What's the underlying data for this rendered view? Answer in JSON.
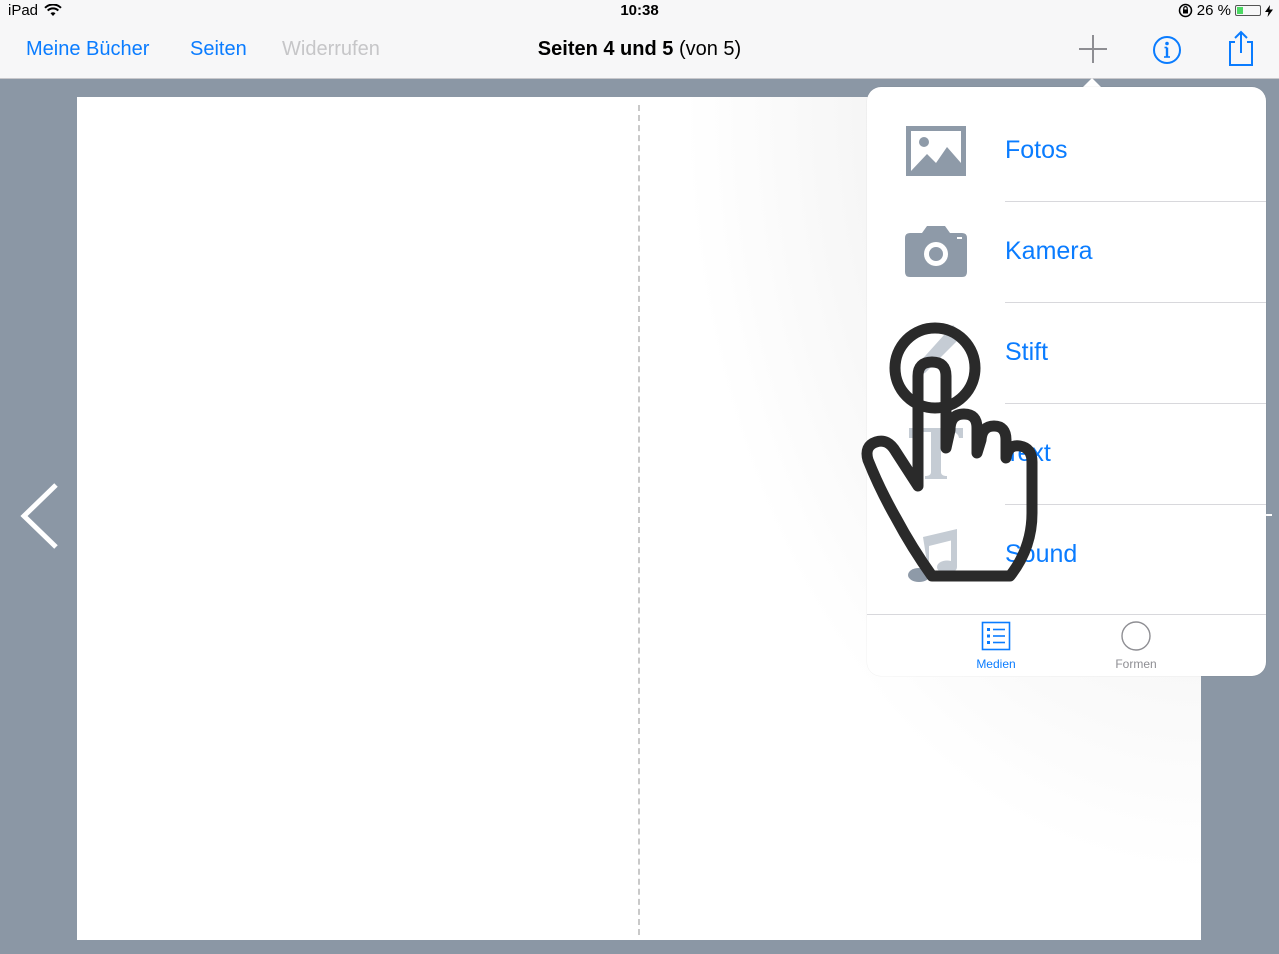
{
  "statusbar": {
    "device": "iPad",
    "time": "10:38",
    "battery": "26 %",
    "battery_level": 0.26
  },
  "navbar": {
    "my_books": "Meine Bücher",
    "pages": "Seiten",
    "undo": "Widerrufen",
    "title_bold": "Seiten 4 und 5",
    "title_rest": " (von 5)"
  },
  "popover": {
    "items": [
      {
        "label": "Fotos",
        "icon": "photo-icon"
      },
      {
        "label": "Kamera",
        "icon": "camera-icon"
      },
      {
        "label": "Stift",
        "icon": "pen-icon"
      },
      {
        "label": "Text",
        "icon": "text-icon"
      },
      {
        "label": "Sound",
        "icon": "music-note-icon"
      }
    ],
    "tabs": [
      {
        "label": "Medien",
        "icon": "list-icon",
        "active": true
      },
      {
        "label": "Formen",
        "icon": "circle-icon",
        "active": false
      }
    ]
  },
  "colors": {
    "accent": "#0a7cff",
    "background": "#8b97a5",
    "icon_gray": "#8e9aa8"
  }
}
